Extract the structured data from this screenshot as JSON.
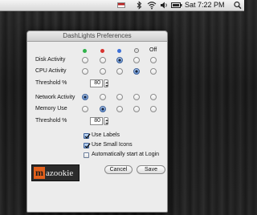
{
  "menubar": {
    "clock": "Sat  7:22 PM",
    "icons": [
      "bluetooth-icon",
      "wifi-icon",
      "volume-icon",
      "battery-icon",
      "flag-icon",
      "spotlight-icon"
    ]
  },
  "window": {
    "title": "DashLights Preferences"
  },
  "columns": {
    "dots": [
      "#2fb34a",
      "#d8332f",
      "#3b6fd8"
    ],
    "off_label": "Off"
  },
  "rows": {
    "disk": {
      "label": "Disk Activity",
      "selected": 2
    },
    "cpu": {
      "label": "CPU Activity",
      "selected": 3
    },
    "threshold1": {
      "label": "Threshold %",
      "value": "80"
    },
    "network": {
      "label": "Network Activity",
      "selected": 0
    },
    "memory": {
      "label": "Memory Use",
      "selected": 1
    },
    "threshold2": {
      "label": "Threshold %",
      "value": "80"
    }
  },
  "options": {
    "use_labels": {
      "label": "Use Labels",
      "checked": true
    },
    "small_icons": {
      "label": "Use Small Icons",
      "checked": true
    },
    "auto_start": {
      "label": "Automatically start at Login",
      "checked": false
    }
  },
  "logo": {
    "initial": "m",
    "rest": "azookie"
  },
  "buttons": {
    "cancel": "Cancel",
    "save": "Save"
  }
}
